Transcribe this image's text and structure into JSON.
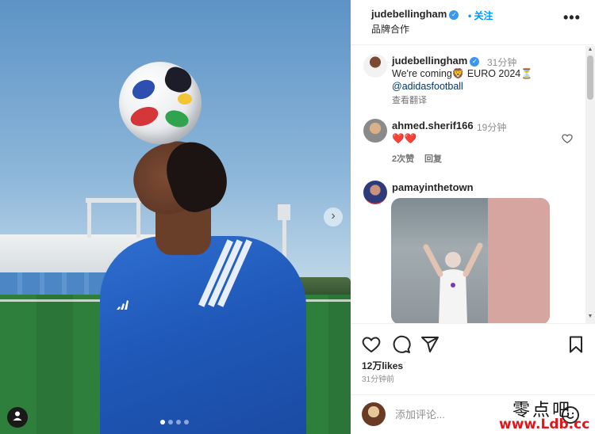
{
  "post": {
    "author": "judebellingham",
    "follow_label": "关注",
    "subtitle": "品牌合作",
    "more_label": "•••"
  },
  "media": {
    "next_label": "›",
    "dots_count": 4,
    "active_dot": 0
  },
  "caption": {
    "username": "judebellingham",
    "time": "31分钟",
    "text": "We're coming🦁 EURO 2024⏳",
    "mention": "@adidasfootball",
    "translate": "查看翻译"
  },
  "comments": [
    {
      "username": "ahmed.sherif166",
      "time": "19分钟",
      "text": "❤️❤️",
      "likes_label": "2次赞",
      "reply_label": "回复"
    },
    {
      "username": "pamayinthetown"
    }
  ],
  "stats": {
    "likes": "12万likes",
    "posted": "31分钟前"
  },
  "add_comment": {
    "placeholder": "添加评论..."
  },
  "watermark": {
    "cn": "零点吧",
    "url": "www.Ldb.cc"
  },
  "colors": {
    "link": "#0095f6",
    "verified": "#3897f0",
    "muted": "#8e8e8e"
  }
}
